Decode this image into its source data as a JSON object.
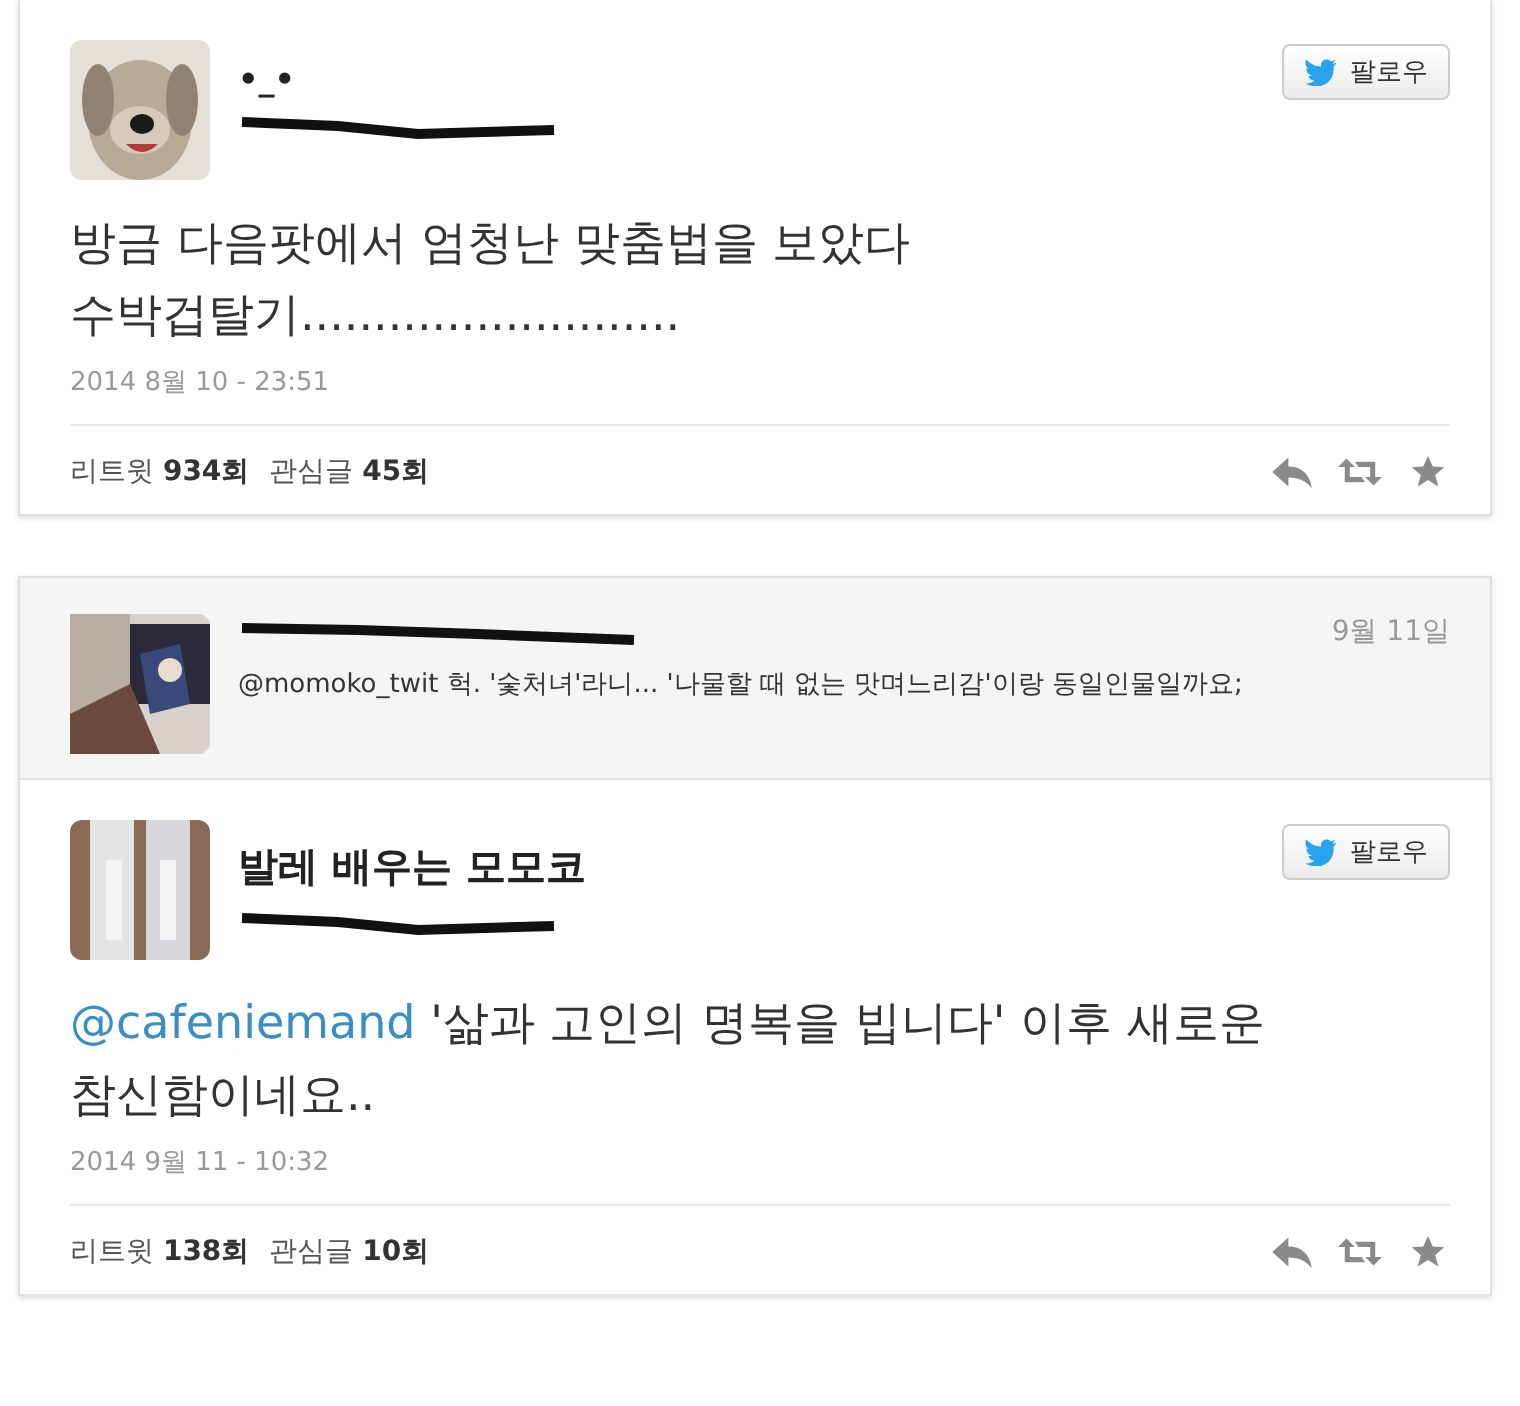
{
  "tweets": [
    {
      "name": "•_•",
      "follow_label": "팔로우",
      "text": [
        {
          "kind": "plain",
          "text": "방금 다음팟에서 엄청난 맞춤법을 보았다 수박겁탈기.........................."
        }
      ],
      "timestamp": "2014 8월 10 - 23:51",
      "stats": [
        {
          "label": "리트윗",
          "count": "934회"
        },
        {
          "label": "관심글",
          "count": "45회"
        }
      ]
    },
    {
      "reply": {
        "date": "9월 11일",
        "text": "@momoko_twit 헉. '숯처녀'라니... '나물할 때 없는 맛며느리감'이랑 동일인물일까요;"
      },
      "name": "발레 배우는 모모코",
      "follow_label": "팔로우",
      "text": [
        {
          "kind": "mention",
          "text": "@cafeniemand"
        },
        {
          "kind": "plain",
          "text": " '삶과 고인의 명복을 빕니다' 이후 새로운 참신함이네요.."
        }
      ],
      "timestamp": "2014 9월 11 - 10:32",
      "stats": [
        {
          "label": "리트윗",
          "count": "138회"
        },
        {
          "label": "관심글",
          "count": "10회"
        }
      ]
    }
  ]
}
